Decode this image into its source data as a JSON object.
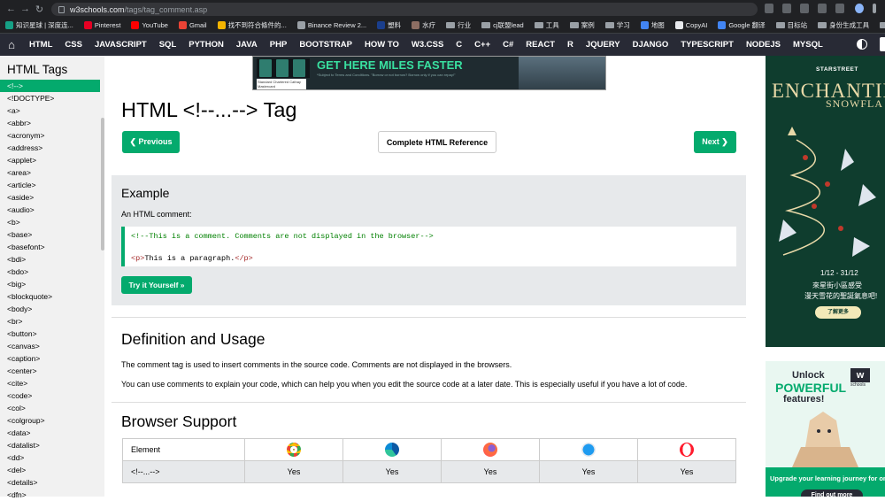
{
  "browser": {
    "url_host": "w3schools.com",
    "url_path": "/tags/tag_comment.asp",
    "bookmarks": [
      {
        "label": "知识星球 | 深度连...",
        "color": "#16a085"
      },
      {
        "label": "Pinterest",
        "color": "#e60023"
      },
      {
        "label": "YouTube",
        "color": "#ff0000"
      },
      {
        "label": "Gmail",
        "color": "#ea4335"
      },
      {
        "label": "找不到符合條件的...",
        "color": "#f4b400"
      },
      {
        "label": "Binance Review 2...",
        "color": "#9aa0a6"
      },
      {
        "label": "塑料",
        "color": "#1a3e8c"
      },
      {
        "label": "水疗",
        "color": "#8d6e63"
      },
      {
        "label": "行业",
        "folder": true
      },
      {
        "label": "cj联盟lead",
        "folder": true
      },
      {
        "label": "工具",
        "folder": true
      },
      {
        "label": "案例",
        "folder": true
      },
      {
        "label": "学习",
        "folder": true
      },
      {
        "label": "地图",
        "color": "#4285f4"
      },
      {
        "label": "CopyAI",
        "color": "#e8eaed"
      },
      {
        "label": "Google 翻译",
        "color": "#4285f4"
      },
      {
        "label": "目标站",
        "folder": true
      },
      {
        "label": "身份生成工具",
        "folder": true
      },
      {
        "label": "docker",
        "folder": true
      },
      {
        "label": "Django",
        "folder": true
      }
    ]
  },
  "nav": {
    "items": [
      "HTML",
      "CSS",
      "JAVASCRIPT",
      "SQL",
      "PYTHON",
      "JAVA",
      "PHP",
      "BOOTSTRAP",
      "HOW TO",
      "W3.CSS",
      "C",
      "C++",
      "C#",
      "REACT",
      "R",
      "JQUERY",
      "DJANGO",
      "TYPESCRIPT",
      "NODEJS",
      "MYSQL"
    ]
  },
  "sidebar": {
    "title": "HTML Tags",
    "items": [
      "<!-->",
      "<!DOCTYPE>",
      "<a>",
      "<abbr>",
      "<acronym>",
      "<address>",
      "<applet>",
      "<area>",
      "<article>",
      "<aside>",
      "<audio>",
      "<b>",
      "<base>",
      "<basefont>",
      "<bdi>",
      "<bdo>",
      "<big>",
      "<blockquote>",
      "<body>",
      "<br>",
      "<button>",
      "<canvas>",
      "<caption>",
      "<center>",
      "<cite>",
      "<code>",
      "<col>",
      "<colgroup>",
      "<data>",
      "<datalist>",
      "<dd>",
      "<del>",
      "<details>",
      "<dfn>"
    ]
  },
  "ad_top": {
    "headline": "GET HERE MILES FASTER",
    "fine_print": "*Subject to Terms and Conditions. \"Borrow or not borrow? Borrow only if you can repay!\"",
    "card_caption": "Standard Chartered Cathay Mastercard"
  },
  "page": {
    "title": "HTML <!--...--> Tag",
    "prev_label": "❮ Previous",
    "reference_label": "Complete HTML Reference",
    "next_label": "Next ❯"
  },
  "example": {
    "heading": "Example",
    "label": "An HTML comment:",
    "code_comment": "<!--This is a comment. Comments are not displayed in the browser-->",
    "code_open": "<p>",
    "code_text": "This is a paragraph.",
    "code_close": "</p>",
    "try_label": "Try it Yourself »"
  },
  "definition": {
    "heading": "Definition and Usage",
    "p1": "The comment tag is used to insert comments in the source code. Comments are not displayed in the browsers.",
    "p2": "You can use comments to explain your code, which can help you when you edit the source code at a later date. This is especially useful if you have a lot of code."
  },
  "browser_support": {
    "heading": "Browser Support",
    "header_cell": "Element",
    "element": "<!--...-->",
    "browsers": [
      {
        "icon": "chrome-icon",
        "color": "#4285f4",
        "value": "Yes"
      },
      {
        "icon": "edge-icon",
        "color": "#0c8bd6",
        "value": "Yes"
      },
      {
        "icon": "firefox-icon",
        "color": "#ff7139",
        "value": "Yes"
      },
      {
        "icon": "safari-icon",
        "color": "#1e9bf0",
        "value": "Yes"
      },
      {
        "icon": "opera-icon",
        "color": "#ff1b2d",
        "value": "Yes"
      }
    ]
  },
  "ad_right1": {
    "brand": "STARSTREET",
    "headline": "ENCHANTIN",
    "sub": "SNOWFLA",
    "date": "1/12 - 31/12",
    "line1": "來星街小區感受",
    "line2": "漫天雪花的聖誕氣息吧!",
    "cta": "了解更多"
  },
  "ad_right2": {
    "line1": "Unlock",
    "line2": "POWERFUL",
    "line3": "features!",
    "logo": "w",
    "logo_sub": "schools",
    "tagline": "Upgrade your learning journey for onl",
    "cta": "Find out more"
  },
  "colors": {
    "accent": "#04aa6d",
    "nav_bg": "#282a35"
  }
}
